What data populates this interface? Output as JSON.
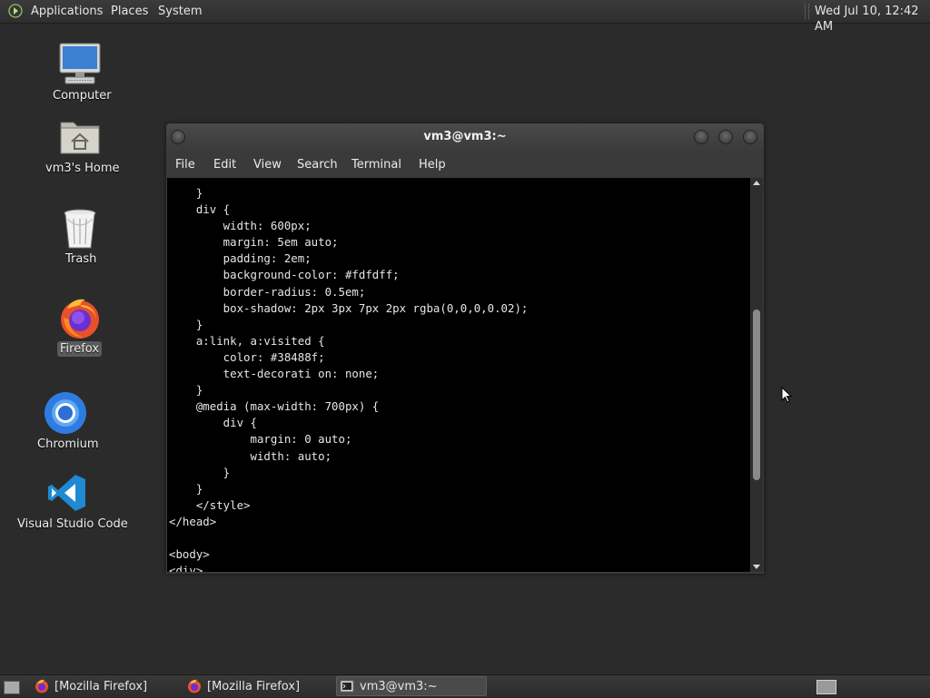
{
  "top_panel": {
    "menu_logo_icon": "gnome-foot-logo",
    "menus": [
      "Applications",
      "Places",
      "System"
    ],
    "clock": "Wed Jul 10, 12:42 AM"
  },
  "desktop_icons": [
    {
      "label": "Computer",
      "icon": "computer-icon"
    },
    {
      "label": "vm3's Home",
      "icon": "home-folder-icon"
    },
    {
      "label": "Trash",
      "icon": "trash-icon"
    },
    {
      "label": "Firefox",
      "icon": "firefox-icon"
    },
    {
      "label": "Chromium",
      "icon": "chromium-icon"
    },
    {
      "label": "Visual Studio Code",
      "icon": "vscode-icon"
    }
  ],
  "terminal": {
    "title": "vm3@vm3:~",
    "menus": [
      "File",
      "Edit",
      "View",
      "Search",
      "Terminal",
      "Help"
    ],
    "lines": [
      "    }",
      "    div {",
      "        width: 600px;",
      "        margin: 5em auto;",
      "        padding: 2em;",
      "        background-color: #fdfdff;",
      "        border-radius: 0.5em;",
      "        box-shadow: 2px 3px 7px 2px rgba(0,0,0,0.02);",
      "    }",
      "    a:link, a:visited {",
      "        color: #38488f;",
      "        text-decorati on: none;",
      "    }",
      "    @media (max-width: 700px) {",
      "        div {",
      "            margin: 0 auto;",
      "            width: auto;",
      "        }",
      "    }",
      "    </style>",
      "</head>",
      "",
      "<body>",
      "<div>"
    ]
  },
  "taskbar": {
    "tasks": [
      {
        "label": "[Mozilla Firefox]",
        "icon": "firefox-icon",
        "active": false
      },
      {
        "label": "[Mozilla Firefox]",
        "icon": "firefox-icon",
        "active": false
      },
      {
        "label": "vm3@vm3:~",
        "icon": "terminal-icon",
        "active": true
      }
    ]
  }
}
